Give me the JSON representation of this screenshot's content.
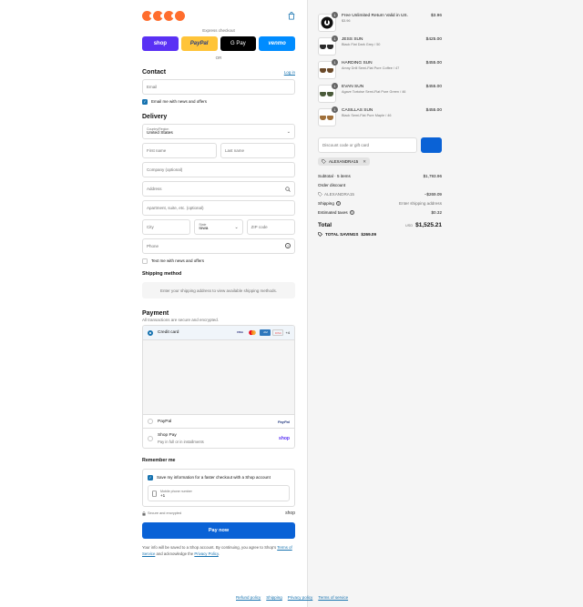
{
  "express": {
    "title": "Express checkout",
    "buttons": [
      "shop",
      "PayPal",
      "G Pay",
      "venmo"
    ],
    "or": "OR"
  },
  "contact": {
    "heading": "Contact",
    "login": "Log in",
    "email_placeholder": "Email",
    "news_label": "Email me with news and offers"
  },
  "delivery": {
    "heading": "Delivery",
    "country_label": "Country/Region",
    "country_value": "United States",
    "first_name": "First name",
    "last_name": "Last name",
    "company": "Company (optional)",
    "address": "Address",
    "apartment": "Apartment, suite, etc. (optional)",
    "city": "City",
    "state_label": "State",
    "state_value": "Iowa",
    "zip": "ZIP code",
    "phone": "Phone",
    "text_label": "Text me with news and offers"
  },
  "shipping": {
    "heading": "Shipping method",
    "note": "Enter your shipping address to view available shipping methods."
  },
  "payment": {
    "heading": "Payment",
    "sub": "All transactions are secure and encrypted.",
    "credit_card": "Credit card",
    "card_more": "+4",
    "paypal": "PayPal",
    "paypal_logo": "PayPal",
    "shop_pay": "Shop Pay",
    "shop_pay_sub": "Pay in full or in installments",
    "shop_logo": "shop"
  },
  "remember": {
    "heading": "Remember me",
    "save_label": "Save my information for a faster checkout with a Shop account",
    "phone_label": "Mobile phone number",
    "phone_value": "+1",
    "secure": "Secure and encrypted",
    "shop_logo": "shop"
  },
  "pay_button": "Pay now",
  "terms": {
    "text1": "Your info will be saved to a Shop account. By continuing, you agree to Shop's",
    "tos": "Terms of Service",
    "text2": "and acknowledge the",
    "privacy": "Privacy Policy",
    "end": "."
  },
  "footer": [
    "Refund policy",
    "Shipping",
    "Privacy policy",
    "Terms of service"
  ],
  "summary": {
    "items": [
      {
        "title": "Free Unlimited Return Valid in US.",
        "sub": "$3.96",
        "price": "$3.96",
        "qty": "1",
        "kind": "badge"
      },
      {
        "title": "JESS SUN",
        "sub": "Black Flat Dark Grey / 50",
        "price": "$425.00",
        "qty": "1",
        "kind": "glasses",
        "lens": "#2a2a2a"
      },
      {
        "title": "HARDING SUN",
        "sub": "Amny Drill Semi-Flat Pure Coffee / 47",
        "price": "$455.00",
        "qty": "1",
        "kind": "glasses",
        "lens": "#6b4a2a"
      },
      {
        "title": "EVAN SUN",
        "sub": "Agave Tortoise Semi-Flat Pure Green / 46",
        "price": "$455.00",
        "qty": "1",
        "kind": "glasses",
        "lens": "#4a5a3a"
      },
      {
        "title": "CASILLAS SUN",
        "sub": "Black Semi-Flat Pure Maple / 46",
        "price": "$455.00",
        "qty": "1",
        "kind": "glasses",
        "lens": "#a0703a"
      }
    ],
    "discount_placeholder": "Discount code or gift card",
    "code": "ALEXANDRA15",
    "subtotal_label": "Subtotal · 5 items",
    "subtotal": "$1,793.96",
    "order_discount": "Order discount",
    "discount_code": "ALEXANDRA15",
    "discount_amount": "−$269.09",
    "shipping_label": "Shipping",
    "shipping_value": "Enter shipping address",
    "taxes_label": "Estimated taxes",
    "taxes_value": "$0.32",
    "total_label": "Total",
    "currency": "USD",
    "total": "$1,525.21",
    "savings_label": "TOTAL SAVINGS",
    "savings": "$269.09"
  },
  "colors": {
    "accent": "#1773b0",
    "pay_button": "#0a62d6",
    "logo": "#ff6d2d"
  }
}
